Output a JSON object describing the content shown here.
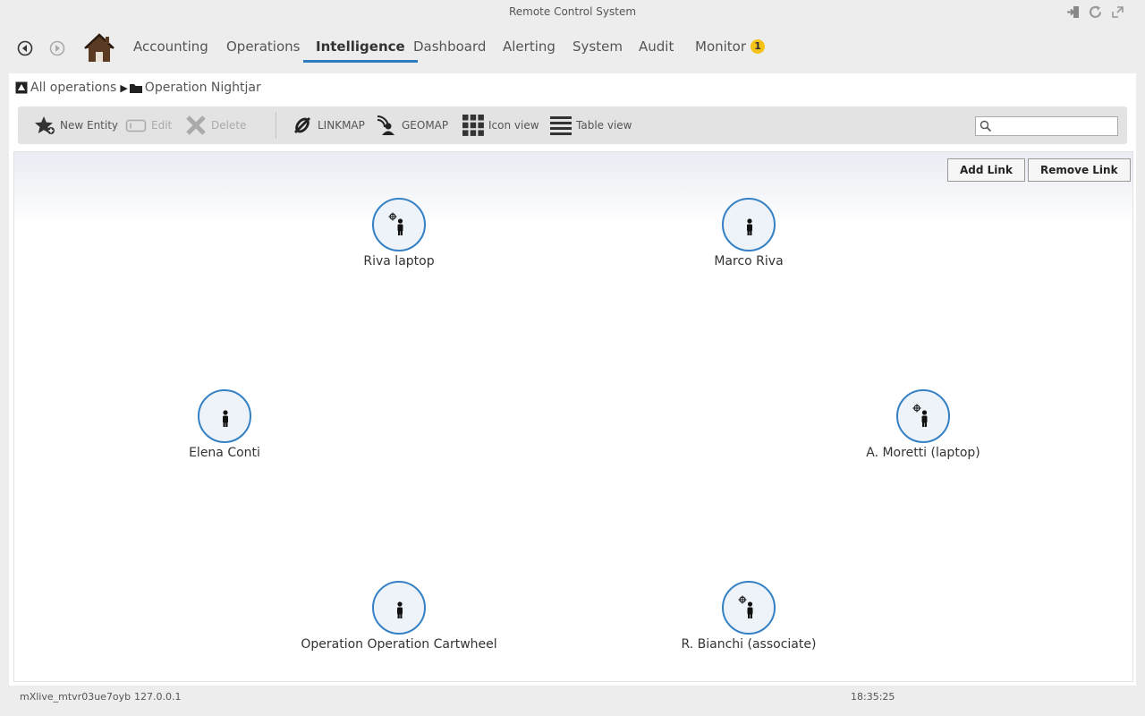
{
  "window": {
    "title": "Remote Control System",
    "controls": [
      "logout-icon",
      "refresh-icon",
      "maximize-icon"
    ]
  },
  "nav": {
    "tabs": [
      "Accounting",
      "Operations",
      "Intelligence",
      "Dashboard",
      "Alerting",
      "System",
      "Audit",
      "Monitor"
    ],
    "active_tab": "Intelligence",
    "monitor_badge": "1",
    "accent_color": "#2f7bbf",
    "badge_color": "#f5c318"
  },
  "breadcrumb": {
    "root": "All operations",
    "current": "Operation Nightjar"
  },
  "toolbar": {
    "new_entity": "New Entity",
    "edit": "Edit",
    "delete": "Delete",
    "linkmap": "LINKMAP",
    "geomap": "GEOMAP",
    "icon_view": "Icon view",
    "table_view": "Table view",
    "search_value": ""
  },
  "canvas": {
    "add_link": "Add Link",
    "remove_link": "Remove Link",
    "node_border_color": "#3581c4",
    "nodes": [
      {
        "label": "Riva laptop",
        "icon": "target-person-icon"
      },
      {
        "label": "Marco Riva",
        "icon": "person-icon"
      },
      {
        "label": "Elena Conti",
        "icon": "person-icon"
      },
      {
        "label": "A. Moretti (laptop)",
        "icon": "target-person-icon"
      },
      {
        "label": "Operation Operation Cartwheel",
        "icon": "person-icon"
      },
      {
        "label": "R. Bianchi (associate)",
        "icon": "target-person-icon"
      }
    ]
  },
  "status": {
    "session": "mXlive_mtvr03ue7oyb",
    "ip": "127.0.0.1",
    "time": "18:35:25"
  }
}
